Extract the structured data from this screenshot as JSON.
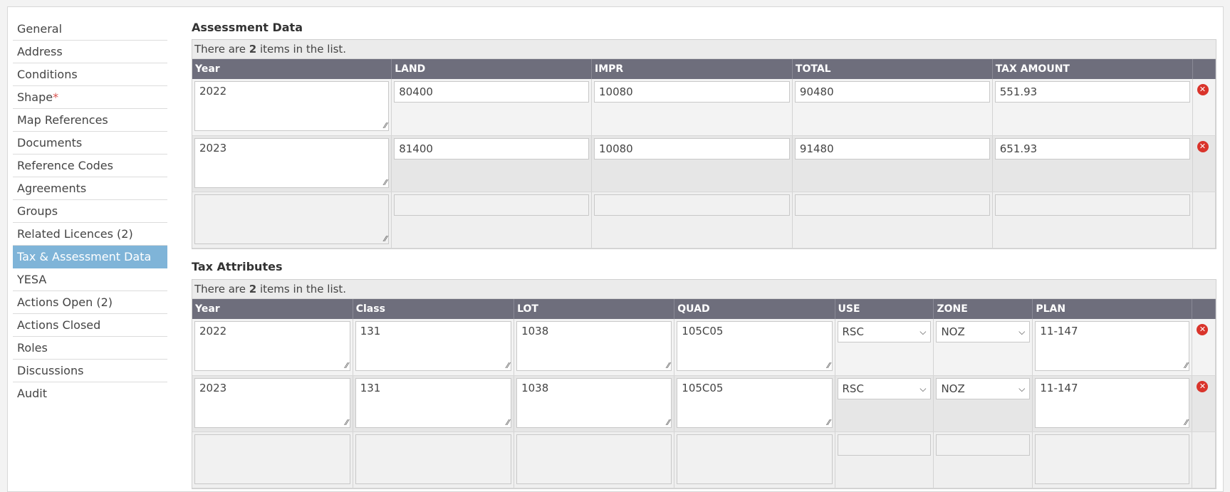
{
  "sidebar": {
    "items": [
      {
        "label": "General"
      },
      {
        "label": "Address"
      },
      {
        "label": "Conditions"
      },
      {
        "label": "Shape",
        "required": "*"
      },
      {
        "label": "Map References"
      },
      {
        "label": "Documents"
      },
      {
        "label": "Reference Codes"
      },
      {
        "label": "Agreements"
      },
      {
        "label": "Groups"
      },
      {
        "label": "Related Licences (2)"
      },
      {
        "label": "Tax & Assessment Data",
        "active": true
      },
      {
        "label": "YESA"
      },
      {
        "label": "Actions Open (2)"
      },
      {
        "label": "Actions Closed"
      },
      {
        "label": "Roles"
      },
      {
        "label": "Discussions"
      },
      {
        "label": "Audit"
      }
    ]
  },
  "assessment": {
    "title": "Assessment Data",
    "count_prefix": "There are ",
    "count": "2",
    "count_suffix": " items in the list.",
    "columns": [
      "Year",
      "LAND",
      "IMPR",
      "TOTAL",
      "TAX AMOUNT"
    ],
    "rows": [
      {
        "year": "2022",
        "land": "80400",
        "impr": "10080",
        "total": "90480",
        "tax": "551.93"
      },
      {
        "year": "2023",
        "land": "81400",
        "impr": "10080",
        "total": "91480",
        "tax": "651.93"
      }
    ]
  },
  "tax_attributes": {
    "title": "Tax Attributes",
    "count_prefix": "There are ",
    "count": "2",
    "count_suffix": " items in the list.",
    "columns": [
      "Year",
      "Class",
      "LOT",
      "QUAD",
      "USE",
      "ZONE",
      "PLAN"
    ],
    "rows": [
      {
        "year": "2022",
        "class": "131",
        "lot": "1038",
        "quad": "105C05",
        "use": "RSC",
        "zone": "NOZ",
        "plan": "11-147"
      },
      {
        "year": "2023",
        "class": "131",
        "lot": "1038",
        "quad": "105C05",
        "use": "RSC",
        "zone": "NOZ",
        "plan": "11-147"
      }
    ]
  },
  "icons": {
    "delete": "delete-circle-icon",
    "resize": "resize-grip-icon",
    "dropdown": "chevron-down-icon"
  },
  "colors": {
    "header_bg": "#6e6e7c",
    "active_nav": "#7fb4d8",
    "delete": "#d9342b"
  }
}
